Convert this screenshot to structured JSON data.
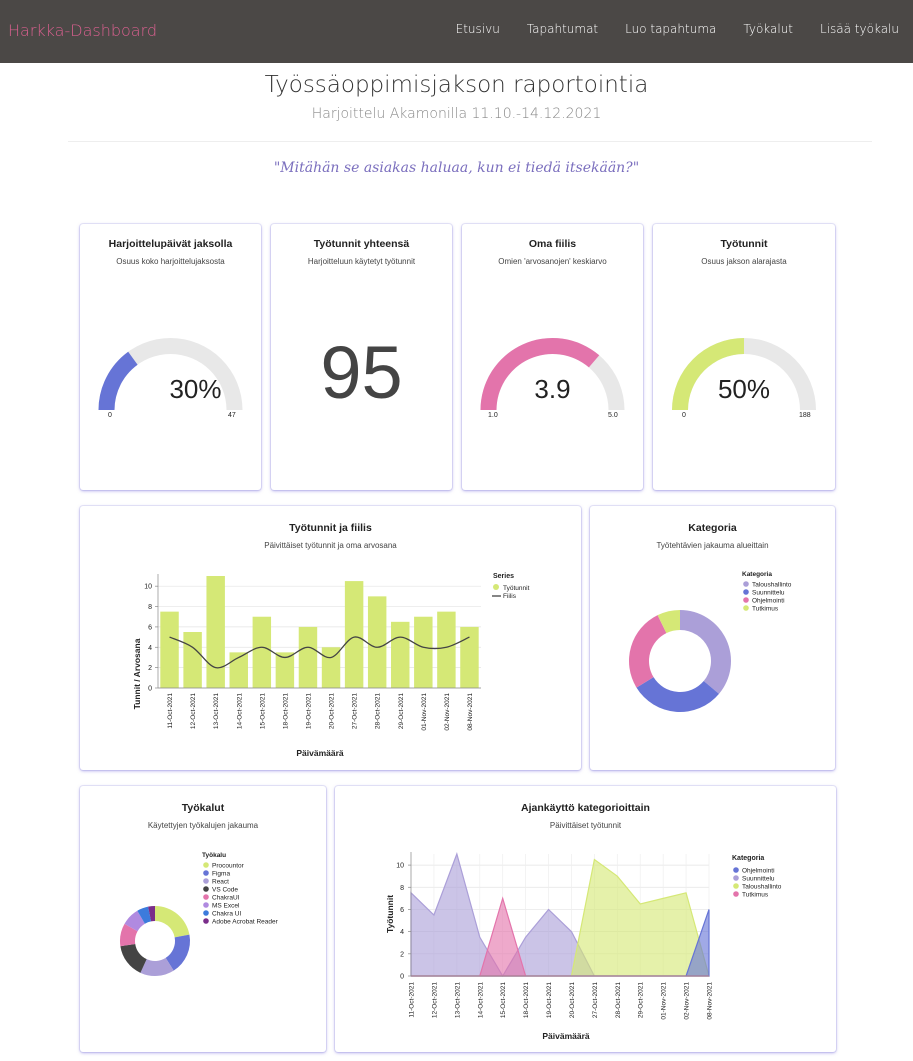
{
  "nav": {
    "brand": "Harkka-Dashboard",
    "links": [
      "Etusivu",
      "Tapahtumat",
      "Luo tapahtuma",
      "Työkalut",
      "Lisää työkalu"
    ]
  },
  "header": {
    "title": "Työssäoppimisjakson raportointia",
    "subtitle": "Harjoittelu Akamonilla 11.10.-14.12.2021",
    "quote": "\"Mitähän se asiakas haluaa, kun ei tiedä itsekään?\""
  },
  "colors": {
    "blue": "#6674d6",
    "pink": "#e374ab",
    "green": "#d5e876",
    "lavender": "#ab9fd8",
    "gray": "#e8e8e8",
    "brand": "#d9608f"
  },
  "gauges": [
    {
      "title": "Harjoittelupäivät jaksolla",
      "subtitle": "Osuus koko harjoittelujaksosta",
      "value_text": "30%",
      "min": "0",
      "max": "47",
      "fraction": 0.3,
      "color": "#6674d6"
    },
    {
      "title": "Oma fiilis",
      "subtitle": "Omien 'arvosanojen' keskiarvo",
      "value_text": "3.9",
      "min": "1.0",
      "max": "5.0",
      "fraction": 0.725,
      "color": "#e374ab"
    },
    {
      "title": "Työtunnit",
      "subtitle": "Osuus jakson alarajasta",
      "value_text": "50%",
      "min": "0",
      "max": "188",
      "fraction": 0.5,
      "color": "#d5e876"
    }
  ],
  "total_hours": {
    "title": "Työtunnit yhteensä",
    "subtitle": "Harjoitteluun käytetyt työtunnit",
    "value": "95"
  },
  "hours_chart": {
    "title": "Työtunnit ja fiilis",
    "subtitle": "Päivittäiset työtunnit ja oma arvosana",
    "legend_title": "Series",
    "legend": [
      "Työtunnit",
      "Fiilis"
    ]
  },
  "category_chart": {
    "title": "Kategoria",
    "subtitle": "Työtehtävien jakauma alueittain",
    "legend_title": "Kategoria"
  },
  "tools_chart": {
    "title": "Työkalut",
    "subtitle": "Käytettyjen työkalujen jakauma",
    "legend_title": "Työkalu"
  },
  "time_chart": {
    "title": "Ajankäyttö kategorioittain",
    "subtitle": "Päivittäiset työtunnit",
    "legend_title": "Kategoria"
  },
  "chart_data": [
    {
      "type": "bar",
      "categories": [
        "11-Oct-2021",
        "12-Oct-2021",
        "13-Oct-2021",
        "14-Oct-2021",
        "15-Oct-2021",
        "18-Oct-2021",
        "19-Oct-2021",
        "20-Oct-2021",
        "27-Oct-2021",
        "28-Oct-2021",
        "29-Oct-2021",
        "01-Nov-2021",
        "02-Nov-2021",
        "08-Nov-2021"
      ],
      "series": [
        {
          "name": "Työtunnit",
          "type": "bar",
          "color": "#d5e876",
          "values": [
            7.5,
            5.5,
            11,
            3.5,
            7,
            3.5,
            6,
            4,
            10.5,
            9,
            6.5,
            7,
            7.5,
            6
          ]
        },
        {
          "name": "Fiilis",
          "type": "line",
          "color": "#444444",
          "values": [
            5,
            4,
            2,
            3,
            4,
            3,
            4,
            3,
            5,
            4,
            5,
            4,
            4,
            5
          ]
        }
      ],
      "xlabel": "Päivämäärä",
      "ylabel": "Tunnit / Arvosana",
      "ylim": [
        0,
        11
      ],
      "yticks": [
        0,
        2,
        4,
        6,
        8,
        10
      ],
      "grid": true,
      "legend_position": "right"
    },
    {
      "type": "pie",
      "donut": true,
      "categories": [
        "Taloushallinto",
        "Suunnittelu",
        "Ohjelmointi",
        "Tutkimus"
      ],
      "values": [
        30,
        25,
        22,
        6
      ],
      "colors": [
        "#ab9fd8",
        "#6674d6",
        "#e374ab",
        "#d5e876"
      ],
      "legend_position": "top-right"
    },
    {
      "type": "pie",
      "donut": true,
      "categories": [
        "Procountor",
        "Figma",
        "React",
        "VS Code",
        "ChakraUI",
        "MS Excel",
        "Chakra UI",
        "Adobe Acrobat Reader"
      ],
      "values": [
        21,
        18,
        15,
        15,
        10,
        8,
        5,
        3
      ],
      "colors": [
        "#d5e876",
        "#6674d6",
        "#ab9fd8",
        "#444444",
        "#e374ab",
        "#b08ae0",
        "#3c7bdc",
        "#7a2e8a"
      ],
      "legend_position": "top-right"
    },
    {
      "type": "area",
      "categories": [
        "11-Oct-2021",
        "12-Oct-2021",
        "13-Oct-2021",
        "14-Oct-2021",
        "15-Oct-2021",
        "18-Oct-2021",
        "19-Oct-2021",
        "20-Oct-2021",
        "27-Oct-2021",
        "28-Oct-2021",
        "29-Oct-2021",
        "01-Nov-2021",
        "02-Nov-2021",
        "08-Nov-2021"
      ],
      "series": [
        {
          "name": "Ohjelmointi",
          "color": "#6674d6",
          "values": [
            0,
            0,
            0,
            0,
            0,
            0,
            0,
            0,
            0,
            0,
            0,
            0,
            0,
            6
          ]
        },
        {
          "name": "Suunnittelu",
          "color": "#ab9fd8",
          "values": [
            7.5,
            5.5,
            11,
            3.5,
            0,
            3.5,
            6,
            4,
            0,
            0,
            0,
            0,
            0,
            0
          ]
        },
        {
          "name": "Taloushallinto",
          "color": "#d5e876",
          "values": [
            0,
            0,
            0,
            0,
            0,
            0,
            0,
            0,
            10.5,
            9,
            6.5,
            7,
            7.5,
            0
          ]
        },
        {
          "name": "Tutkimus",
          "color": "#e374ab",
          "values": [
            0,
            0,
            0,
            0,
            7,
            0,
            0,
            0,
            0,
            0,
            0,
            0,
            0,
            0
          ]
        }
      ],
      "xlabel": "Päivämäärä",
      "ylabel": "Työtunnit",
      "ylim": [
        0,
        11
      ],
      "yticks": [
        0,
        2,
        4,
        6,
        8,
        10
      ],
      "grid": true,
      "legend_position": "right"
    }
  ]
}
